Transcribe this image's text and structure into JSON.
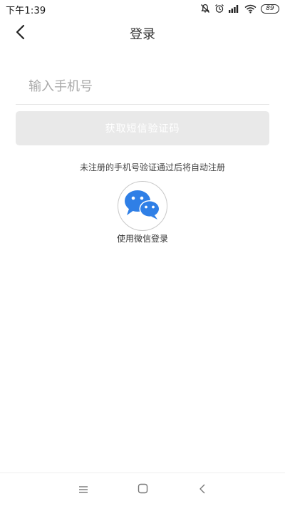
{
  "status_bar": {
    "time": "下午1:39",
    "battery": "89",
    "icons": [
      "mute-icon",
      "alarm-icon",
      "signal-icon",
      "wifi-icon",
      "battery-icon"
    ]
  },
  "header": {
    "title": "登录",
    "back_icon": "chevron-left-icon"
  },
  "phone_input": {
    "placeholder": "输入手机号",
    "value": ""
  },
  "sms_button": {
    "label": "获取短信验证码",
    "background": "#e9e9e9",
    "text_color": "#ffffff"
  },
  "register_hint": "未注册的手机号验证通过后将自动注册",
  "wechat_login": {
    "label": "使用微信登录",
    "icon": "wechat-icon",
    "icon_color": "#2f7fe6"
  },
  "nav_bar": {
    "icons": [
      "menu-icon",
      "home-icon",
      "back-icon"
    ]
  }
}
